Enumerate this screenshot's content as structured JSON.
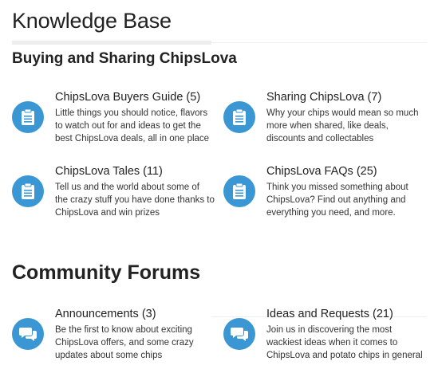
{
  "knowledge_base": {
    "title": "Knowledge Base",
    "section_title": "Buying and Sharing ChipsLova",
    "articles": [
      {
        "title": "ChipsLova Buyers Guide (5)",
        "description": "Little things you should notice, flavors to watch out for and ideas to get the best ChipsLova deals, all in one place",
        "icon": "clipboard-icon"
      },
      {
        "title": "Sharing ChipsLova (7)",
        "description": "Why your chips would mean so much more when shared, like deals, discounts and collectables",
        "icon": "clipboard-icon"
      },
      {
        "title": "ChipsLova Tales (11)",
        "description": "Tell us and the world about some of the crazy stuff you have done thanks to ChipsLova and win prizes",
        "icon": "clipboard-icon"
      },
      {
        "title": "ChipsLova FAQs (25)",
        "description": "Think you missed something about ChipsLova? Find out anything and everything you need, and more.",
        "icon": "clipboard-icon"
      }
    ]
  },
  "community_forums": {
    "title": "Community Forums",
    "forums": [
      {
        "title": "Announcements (3)",
        "description": "Be the first to know about exciting ChipsLova offers, and some crazy updates about some chips",
        "icon": "chat-bubbles-icon"
      },
      {
        "title": "Ideas and Requests (21)",
        "description": "Join us in discovering the most wackiest ideas when it comes to ChipsLova and potato chips in general",
        "icon": "chat-bubbles-icon"
      }
    ]
  },
  "colors": {
    "icon_circle": "#3a97d4",
    "text": "#333333",
    "heading": "#222222"
  }
}
